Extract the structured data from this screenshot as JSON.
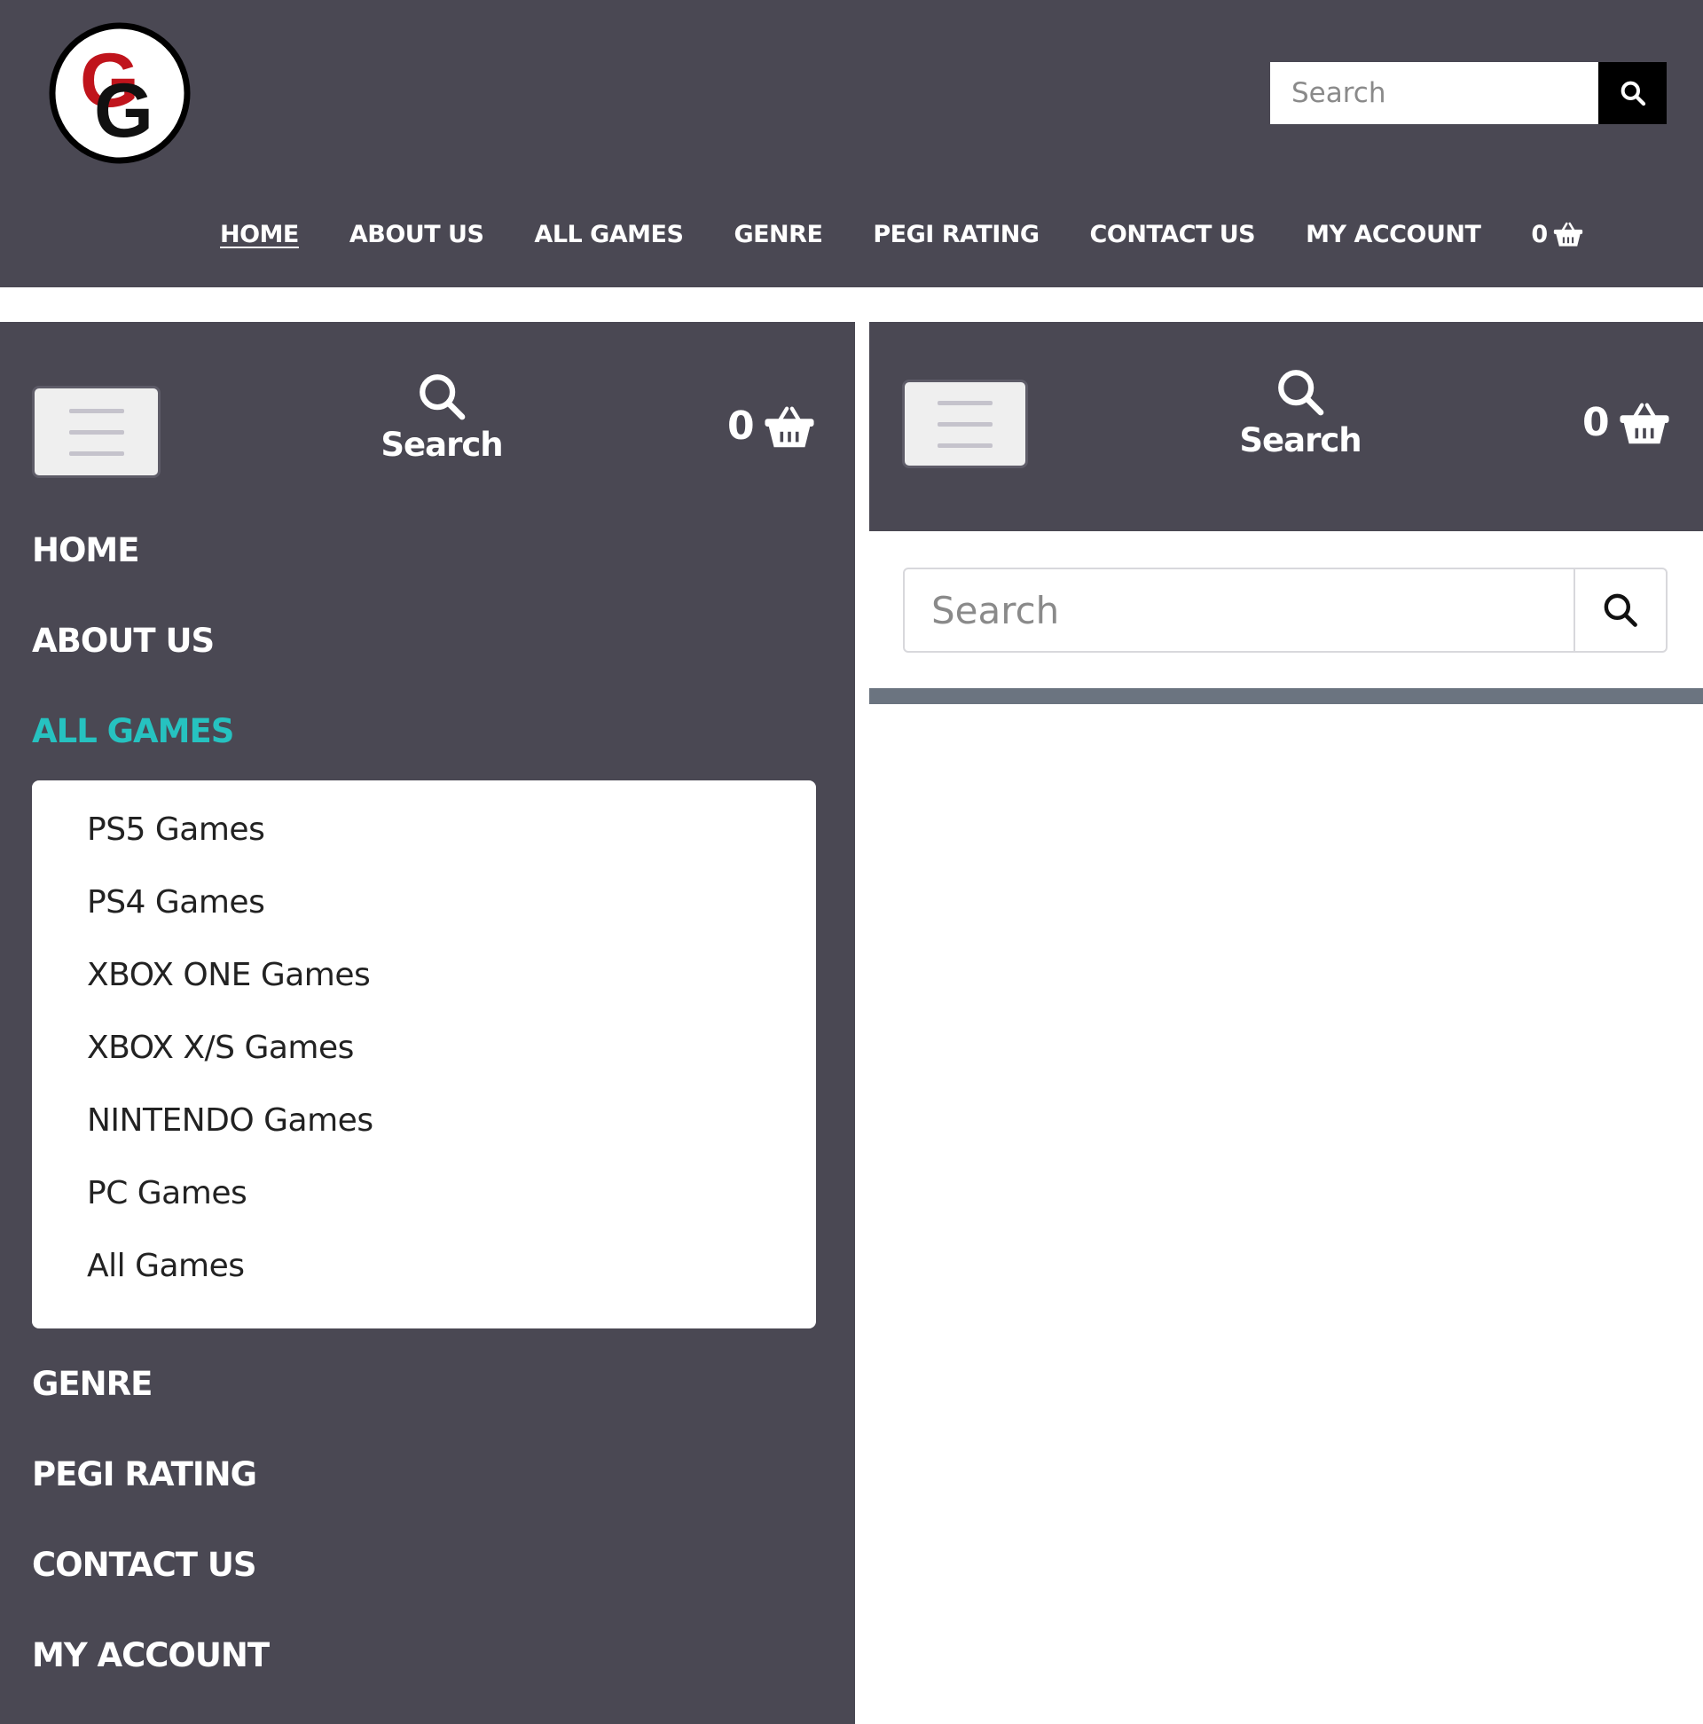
{
  "logo": {
    "letter_top": "G",
    "letter_bottom": "G"
  },
  "colors": {
    "header_bg": "#4a4853",
    "accent": "#26c2c0",
    "logo_red": "#c0141c",
    "search_button": "#000000",
    "divider_bar": "#6b7480"
  },
  "desktop": {
    "search": {
      "placeholder": "Search",
      "button_icon": "search-icon"
    },
    "nav": {
      "home": "HOME",
      "about": "ABOUT US",
      "all_games": "ALL GAMES",
      "genre": "GENRE",
      "pegi": "PEGI RATING",
      "contact": "CONTACT US",
      "account": "MY ACCOUNT"
    },
    "cart": {
      "count": "0",
      "icon": "basket-icon"
    }
  },
  "mobile": {
    "search_toggle_label": "Search",
    "cart_count": "0",
    "nav": {
      "home": "HOME",
      "about": "ABOUT US",
      "all_games": "ALL GAMES",
      "genre": "GENRE",
      "pegi": "PEGI RATING",
      "contact": "CONTACT US",
      "account": "MY ACCOUNT"
    },
    "dropdown": {
      "ps5": "PS5 Games",
      "ps4": "PS4 Games",
      "xbox_one": "XBOX ONE Games",
      "xbox_xs": "XBOX X/S Games",
      "nintendo": "NINTENDO Games",
      "pc": "PC Games",
      "all": "All Games"
    },
    "search": {
      "placeholder": "Search",
      "button_icon": "search-icon"
    }
  }
}
